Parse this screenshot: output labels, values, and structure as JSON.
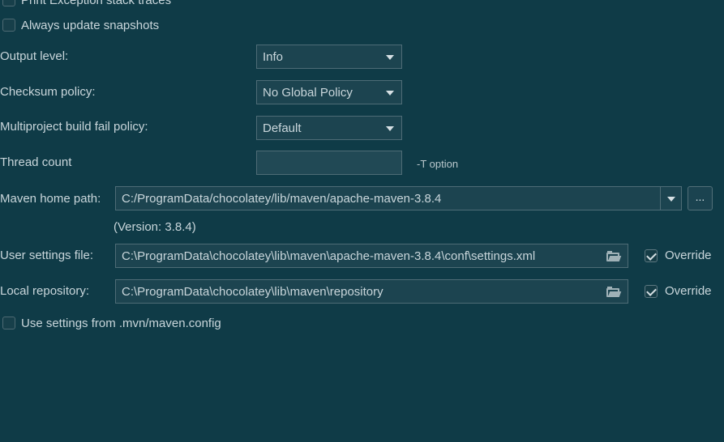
{
  "options": {
    "print_exception_stack_traces": {
      "label": "Print Exception stack traces",
      "checked": false
    },
    "always_update_snapshots": {
      "label": "Always update snapshots",
      "checked": false
    },
    "use_settings_from_mvn": {
      "label": "Use settings from .mvn/maven.config",
      "checked": false
    }
  },
  "output_level": {
    "label": "Output level:",
    "value": "Info"
  },
  "checksum_policy": {
    "label": "Checksum policy:",
    "value": "No Global Policy"
  },
  "multiproject_build_fail_policy": {
    "label": "Multiproject build fail policy:",
    "value": "Default"
  },
  "thread_count": {
    "label": "Thread count",
    "value": "",
    "hint": "-T option"
  },
  "maven_home": {
    "label": "Maven home path:",
    "value": "C:/ProgramData/chocolatey/lib/maven/apache-maven-3.8.4",
    "browse_label": "...",
    "version": "(Version: 3.8.4)"
  },
  "user_settings": {
    "label": "User settings file:",
    "value": "C:\\ProgramData\\chocolatey\\lib\\maven\\apache-maven-3.8.4\\conf\\settings.xml",
    "override_label": "Override",
    "override_checked": true
  },
  "local_repository": {
    "label": "Local repository:",
    "value": "C:\\ProgramData\\chocolatey\\lib\\maven\\repository",
    "override_label": "Override",
    "override_checked": true
  },
  "colors": {
    "background": "#0f3b47",
    "field_background": "#1c4450",
    "border": "#4e6c76",
    "text": "#c9d6db"
  }
}
